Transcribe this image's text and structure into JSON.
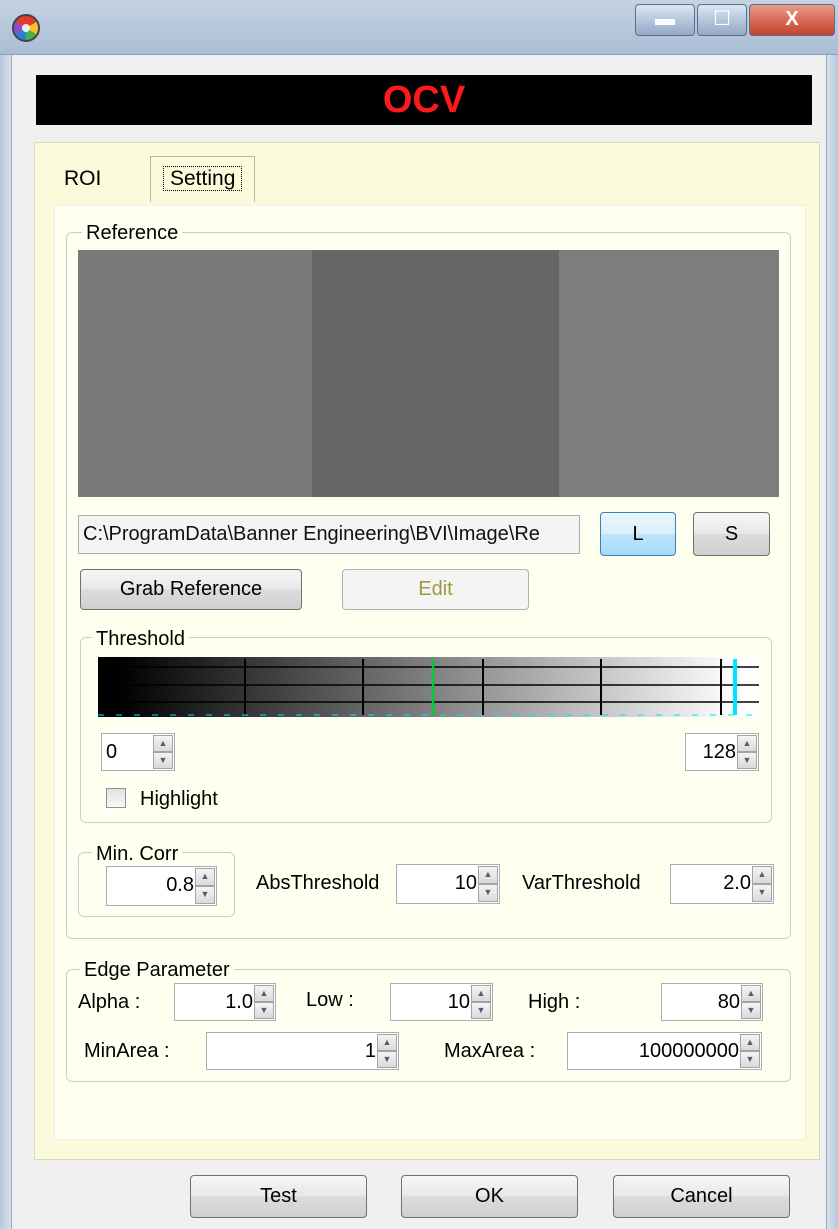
{
  "window": {
    "buttons": {
      "minimize": "▬",
      "maximize": "☐",
      "close": "X"
    }
  },
  "banner": {
    "title": "OCV"
  },
  "tabs": [
    {
      "label": "ROI"
    },
    {
      "label": "Setting",
      "selected": true
    }
  ],
  "reference": {
    "group_label": "Reference",
    "path_value": "C:\\ProgramData\\Banner Engineering\\BVI\\Image\\Re",
    "load_button": "L",
    "save_button": "S",
    "grab_button": "Grab Reference",
    "edit_button": "Edit"
  },
  "threshold": {
    "group_label": "Threshold",
    "low_value": "0",
    "high_value": "128",
    "highlight_label": "Highlight",
    "highlight_checked": false
  },
  "min_corr": {
    "group_label": "Min. Corr",
    "value": "0.8"
  },
  "abs_threshold": {
    "label": "AbsThreshold",
    "value": "10"
  },
  "var_threshold": {
    "label": "VarThreshold",
    "value": "2.0"
  },
  "edge": {
    "group_label": "Edge Parameter",
    "alpha_label": "Alpha :",
    "alpha_value": "1.0",
    "low_label": "Low :",
    "low_value": "10",
    "high_label": "High :",
    "high_value": "80",
    "minarea_label": "MinArea :",
    "minarea_value": "1",
    "maxarea_label": "MaxArea :",
    "maxarea_value": "100000000"
  },
  "footer": {
    "test_button": "Test",
    "ok_button": "OK",
    "cancel_button": "Cancel"
  },
  "colors": {
    "banner_text": "#ff1a1a",
    "panel_bg": "#fffff0",
    "marker_green": "#00cc33",
    "marker_cyan": "#00e5ff"
  }
}
